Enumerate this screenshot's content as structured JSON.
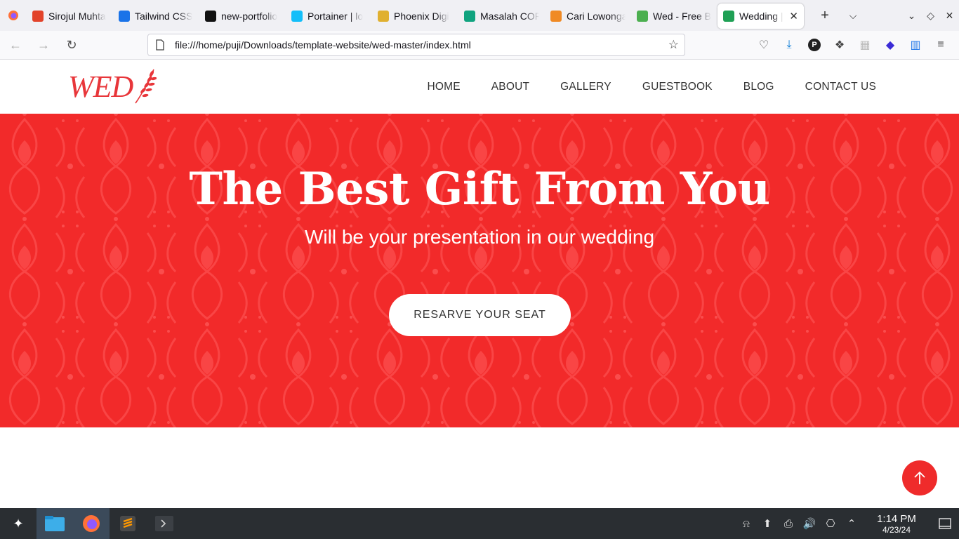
{
  "browser": {
    "tabs": [
      {
        "title": "Sirojul Muhta",
        "icon": "gitlab-icon",
        "color": "#e2432a"
      },
      {
        "title": "Tailwind CSS",
        "icon": "play-icon",
        "color": "#1a73e8"
      },
      {
        "title": "new-portfolio",
        "icon": "github-icon",
        "color": "#111111"
      },
      {
        "title": "Portainer | lo",
        "icon": "portainer-icon",
        "color": "#13bef9"
      },
      {
        "title": "Phoenix Digi",
        "icon": "phoenix-icon",
        "color": "#e0b030"
      },
      {
        "title": "Masalah COR",
        "icon": "openai-icon",
        "color": "#10a37f"
      },
      {
        "title": "Cari Lowonga",
        "icon": "bookmark-icon",
        "color": "#f08a24"
      },
      {
        "title": "Wed - Free B",
        "icon": "leaf-icon",
        "color": "#4caf50"
      },
      {
        "title": "Wedding | ",
        "icon": "check-circle-icon",
        "color": "#1fa055",
        "active": true
      }
    ],
    "url": "file:///home/puji/Downloads/template-website/wed-master/index.html"
  },
  "site": {
    "logo": "WED",
    "menu": [
      "HOME",
      "ABOUT",
      "GALLERY",
      "GUESTBOOK",
      "BLOG",
      "CONTACT US"
    ],
    "hero_title": "The Best Gift From You",
    "hero_subtitle": "Will be your presentation in our wedding",
    "hero_button": "RESARVE YOUR SEAT",
    "accent_color": "#f22a2a"
  },
  "taskbar": {
    "time": "1:14 PM",
    "date": "4/23/24"
  }
}
